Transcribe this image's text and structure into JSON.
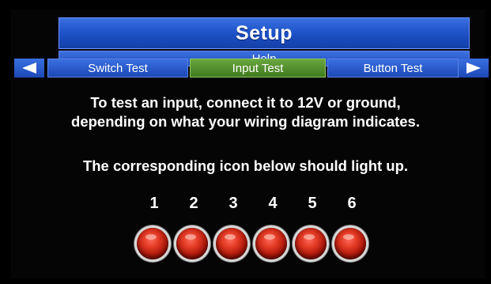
{
  "header": {
    "title": "Setup",
    "help_label": "Help"
  },
  "tabs": [
    {
      "label": "Switch Test",
      "active": false
    },
    {
      "label": "Input Test",
      "active": true
    },
    {
      "label": "Button Test",
      "active": false
    }
  ],
  "nav": {
    "prev_icon": "triangle-left-icon",
    "next_icon": "triangle-right-icon"
  },
  "instructions": {
    "line1": "To test an input, connect it to 12V or ground,",
    "line2": "depending on what your wiring diagram indicates.",
    "hint": "The corresponding icon below should light up."
  },
  "inputs": [
    {
      "number": "1",
      "lit": false
    },
    {
      "number": "2",
      "lit": false
    },
    {
      "number": "3",
      "lit": false
    },
    {
      "number": "4",
      "lit": false
    },
    {
      "number": "5",
      "lit": false
    },
    {
      "number": "6",
      "lit": false
    }
  ],
  "colors": {
    "header_blue": "#1b4fc4",
    "active_tab_green": "#5a9a2e",
    "led_red": "#c41e0e",
    "background": "#000000"
  }
}
